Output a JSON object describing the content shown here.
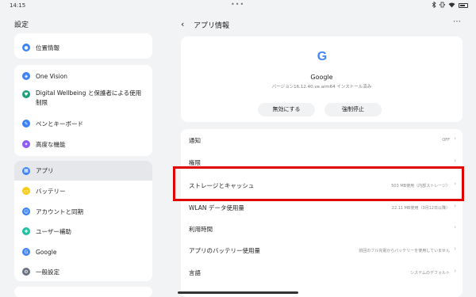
{
  "status": {
    "time": "14:15",
    "dots": "•••"
  },
  "left": {
    "title": "設定",
    "groups": [
      {
        "items": [
          {
            "label": "位置情報",
            "icon": "location-icon",
            "color": "#3b82f6"
          }
        ]
      },
      {
        "items": [
          {
            "label": "One Vision",
            "icon": "one-vision-icon",
            "color": "#3b82f6"
          },
          {
            "label": "Digital Wellbeing と保護者による使用",
            "label2": "制限",
            "icon": "wellbeing-icon",
            "color": "#1aa179"
          },
          {
            "label": "ペンとキーボード",
            "icon": "pen-icon",
            "color": "#3b82f6"
          },
          {
            "label": "高度な機能",
            "icon": "advanced-icon",
            "color": "#8b5cf6"
          }
        ]
      },
      {
        "items": [
          {
            "label": "アプリ",
            "icon": "apps-icon",
            "color": "#3b82f6"
          },
          {
            "label": "バッテリー",
            "icon": "battery-icon",
            "color": "#facc15"
          },
          {
            "label": "アカウントと同期",
            "icon": "account-icon",
            "color": "#3b82f6"
          },
          {
            "label": "ユーザー補助",
            "icon": "accessibility-icon",
            "color": "#22c1a3"
          },
          {
            "label": "Google",
            "icon": "google-icon",
            "color": "#4285f4"
          },
          {
            "label": "一般設定",
            "icon": "general-settings-icon",
            "color": "#6b7280"
          }
        ]
      }
    ]
  },
  "right": {
    "header_title": "アプリ情報",
    "app": {
      "logo": "G",
      "name": "Google",
      "version": "バージョン16.12.40.ve.arm64 インストール済み",
      "disable_label": "無効にする",
      "force_stop_label": "強制停止"
    },
    "rows": [
      {
        "label": "通知",
        "value": "OFF"
      },
      {
        "label": "権限",
        "value": ""
      },
      {
        "label": "ストレージとキャッシュ",
        "value": "503 MB使用（内部ストレージ）"
      },
      {
        "label": "WLAN データ使用量",
        "value": "22.11 MB使用（3月12日以降）"
      },
      {
        "label": "利用時間",
        "value": ""
      },
      {
        "label": "アプリのバッテリー使用量",
        "value": "前回のフル充電からバッテリーを使用していません"
      },
      {
        "label": "言語",
        "value": "システムのデフォルト"
      }
    ]
  }
}
